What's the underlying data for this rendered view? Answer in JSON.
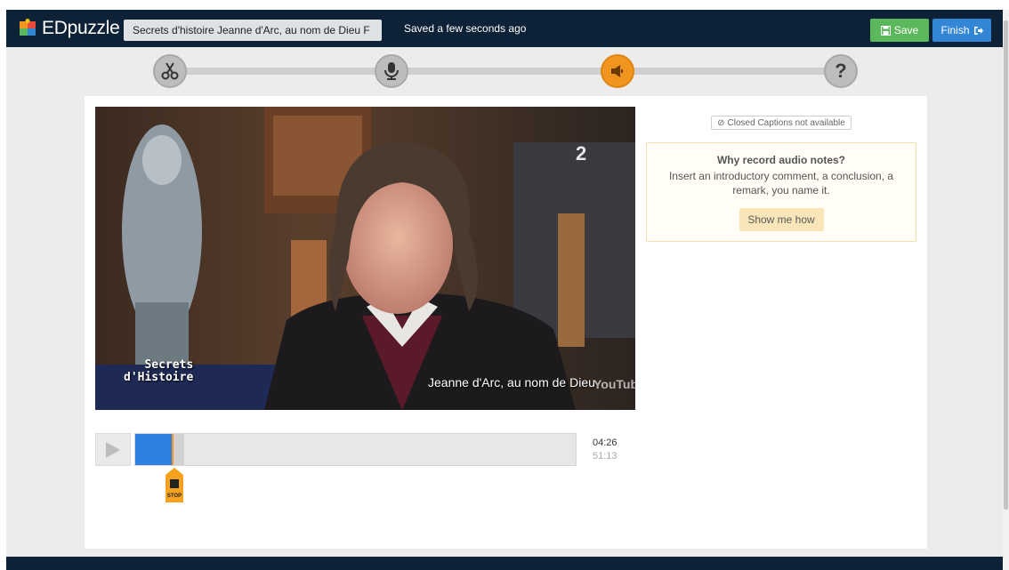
{
  "app": {
    "name": "EDpuzzle"
  },
  "header": {
    "title_value": "Secrets d'histoire  Jeanne d'Arc, au nom de Dieu F",
    "saved_status": "Saved a few seconds ago",
    "save_label": "Save",
    "finish_label": "Finish"
  },
  "steps": [
    {
      "name": "cut",
      "icon": "scissors-icon",
      "active": false
    },
    {
      "name": "voiceover",
      "icon": "microphone-icon",
      "active": false
    },
    {
      "name": "audio-notes",
      "icon": "speaker-icon",
      "active": true
    },
    {
      "name": "quiz",
      "icon": "question-icon",
      "active": false
    }
  ],
  "video": {
    "overlay_show": "Secrets\nd'Histoire",
    "overlay_subtitle": "Jeanne d'Arc, au nom de Dieu",
    "channel_logo": "2",
    "watermark": "YouTube"
  },
  "captions": {
    "label": "Closed Captions not available"
  },
  "tip": {
    "heading": "Why record audio notes?",
    "description": "Insert an introductory comment, a conclusion, a remark, you name it.",
    "button_label": "Show me how"
  },
  "player": {
    "current_time": "04:26",
    "total_time": "51:13",
    "progress_fraction": 0.085,
    "stop_label": "STOP"
  },
  "colors": {
    "navbar": "#0d2237",
    "save_green": "#5cb85c",
    "finish_blue": "#3385d6",
    "accent_orange": "#f0951e",
    "timeline_blue": "#2f7fe0"
  }
}
